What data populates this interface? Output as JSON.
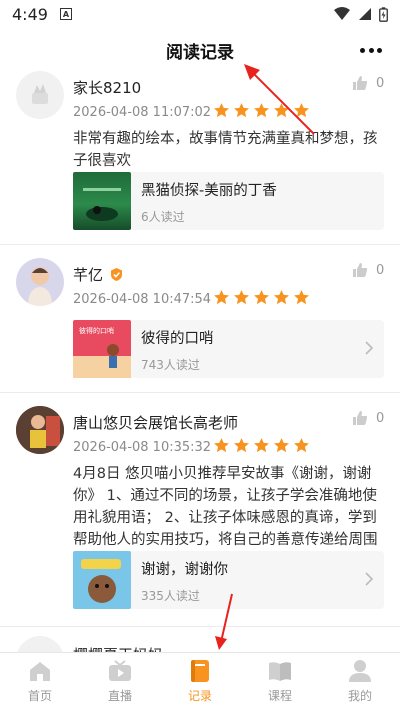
{
  "status_bar": {
    "time": "4:49",
    "indicator": "A"
  },
  "header": {
    "title": "阅读记录"
  },
  "posts": [
    {
      "author": "家长8210",
      "time": "2026-04-08 11:07:02",
      "rating": 5,
      "likes": "0",
      "text": "非常有趣的绘本，故事情节充满童真和梦想，孩子很喜欢",
      "book": {
        "title": "黑猫侦探-美丽的丁香",
        "reads": "6人读过"
      }
    },
    {
      "author": "芊亿",
      "verified": true,
      "time": "2026-04-08 10:47:54",
      "rating": 5,
      "likes": "0",
      "book": {
        "title": "彼得的口哨",
        "reads": "743人读过",
        "cover_text": "彼得的口哨"
      }
    },
    {
      "author": "唐山悠贝会展馆长高老师",
      "time": "2026-04-08 10:35:32",
      "rating": 5,
      "likes": "0",
      "text": "4月8日 悠贝喵小贝推荐早安故事《谢谢，谢谢你》 1、通过不同的场景，让孩子学会准确地使用礼貌用语； 2、让孩子体味感恩的真谛，学到帮助他人的实用技巧，将自己的善意传递给周围",
      "book": {
        "title": "谢谢，谢谢你",
        "reads": "335人读过"
      }
    },
    {
      "author": "樱樱夏天妈妈"
    }
  ],
  "tabs": [
    {
      "label": "首页",
      "icon": "home-icon"
    },
    {
      "label": "直播",
      "icon": "tv-icon"
    },
    {
      "label": "记录",
      "icon": "record-book-icon",
      "active": true
    },
    {
      "label": "课程",
      "icon": "course-book-icon"
    },
    {
      "label": "我的",
      "icon": "profile-icon"
    }
  ],
  "colors": {
    "accent": "#f7931e",
    "annotation_arrow": "#e8231d",
    "star": "#f7931e"
  }
}
